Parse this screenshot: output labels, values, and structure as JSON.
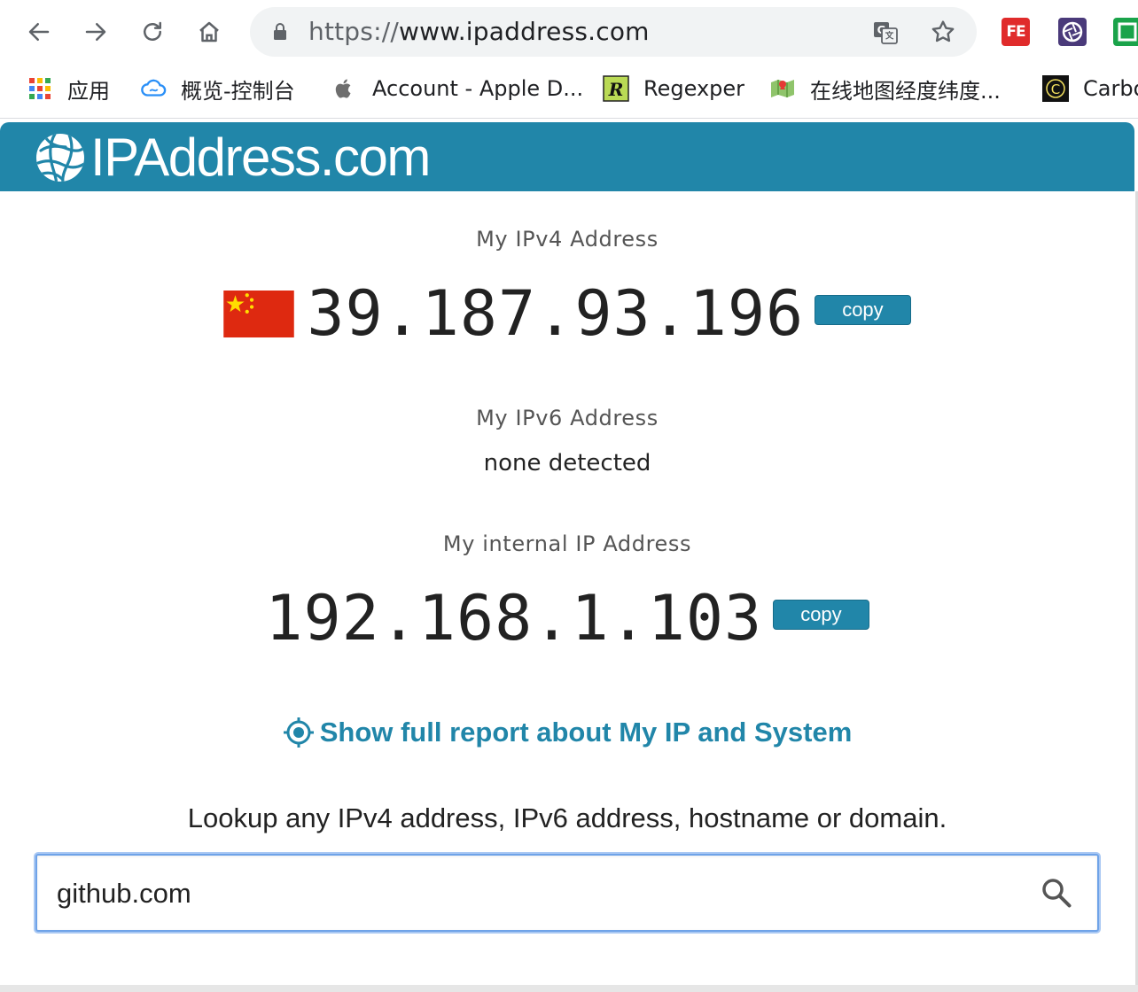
{
  "browser": {
    "url_scheme": "https://",
    "url_host": "www.ipaddress.com",
    "bookmarks": [
      {
        "label": "应用"
      },
      {
        "label": "概览-控制台"
      },
      {
        "label": "Account - Apple D..."
      },
      {
        "label": "Regexper"
      },
      {
        "label": "在线地图经度纬度..."
      },
      {
        "label": "Carbon"
      }
    ],
    "extensions": [
      {
        "label": "FE"
      }
    ]
  },
  "site": {
    "logo_text": "IPAddress.com"
  },
  "ipv4": {
    "label": "My IPv4 Address",
    "value": "39.187.93.196",
    "copy_label": "copy"
  },
  "ipv6": {
    "label": "My IPv6 Address",
    "value": "none detected"
  },
  "internal": {
    "label": "My internal IP Address",
    "value": "192.168.1.103",
    "copy_label": "copy"
  },
  "report_link": "Show full report about My IP and System",
  "lookup": {
    "prompt": "Lookup any IPv4 address, IPv6 address, hostname or domain.",
    "value": "github.com"
  },
  "colors": {
    "brand": "#2186a9",
    "flag_red": "#de2910",
    "flag_yellow": "#ffde00"
  }
}
